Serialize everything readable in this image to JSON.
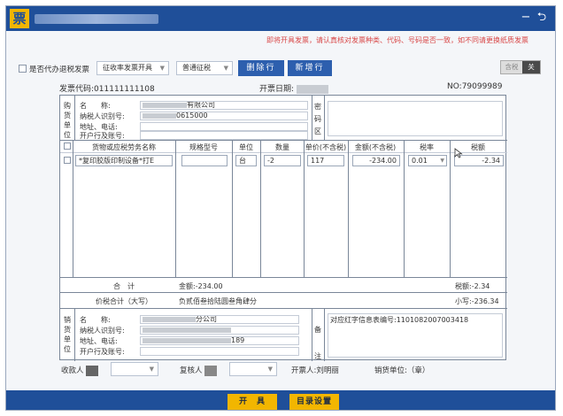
{
  "titlebar": {
    "logo": "票",
    "minimize_icon": "−",
    "back_icon": "⮌"
  },
  "hint": "即将开具发票，请认真核对发票种类、代码、号码是否一致，如不同请更换纸质发票",
  "toolbar": {
    "reverse_checkbox_label": "是否代办退税发票",
    "invoice_mode": "征收率发票开具",
    "tax_type": "普通征税",
    "delete_row_button": "删除行",
    "add_row_button": "新增行",
    "tax_toggle": {
      "included": "含税",
      "excluded": "关"
    }
  },
  "meta": {
    "invoice_code_label": "发票代码:",
    "invoice_code": "011111111108",
    "issue_date_label": "开票日期:",
    "invoice_no_label": "NO:",
    "invoice_no": "79099989"
  },
  "buyer": {
    "side_label": [
      "购",
      "货",
      "单",
      "位"
    ],
    "name_label": "名　　称:",
    "name_value": "有限公司",
    "taxid_label": "纳税人识别号:",
    "taxid_value": "0615000",
    "address_label": "地址、电话:",
    "bank_label": "开户行及账号:",
    "secret_label": [
      "密",
      "码",
      "区"
    ]
  },
  "table": {
    "headers": [
      "货物或应税劳务名称",
      "规格型号",
      "单位",
      "数量",
      "单价(不含税)",
      "金额(不含税)",
      "税率",
      "税额"
    ],
    "row": {
      "name": "*复印胶版印制设备*打E",
      "spec": "",
      "unit": "台",
      "qty": "-2",
      "price": "117",
      "amount": "-234.00",
      "tax_rate": "0.01",
      "tax_amount": "-2.34"
    }
  },
  "totals": {
    "subtotal_label": "合　计",
    "amount_total": "金额:-234.00",
    "tax_total": "税额:-2.34",
    "grand_label": "价税合计（大写）",
    "grand_upper": "负贰佰叁拾陆圆叁角肆分",
    "grand_lower": "小写:-236.34"
  },
  "seller": {
    "side_label": [
      "销",
      "货",
      "单",
      "位"
    ],
    "name_label": "名　　称:",
    "name_value": "分公司",
    "taxid_label": "纳税人识别号:",
    "address_label": "地址、电话:",
    "address_value": "189",
    "bank_label": "开户行及账号:",
    "remark_label": [
      "备",
      "注"
    ],
    "remark": "对应红字信息表编号:1101082007003418"
  },
  "footer": {
    "payee_label": "收款人",
    "reviewer_label": "复核人",
    "drawer": "开票人:刘明丽",
    "seller_seal": "销货单位:（章）"
  },
  "bottom": {
    "issue_button": "开　具",
    "catalog_button": "目录设置"
  }
}
